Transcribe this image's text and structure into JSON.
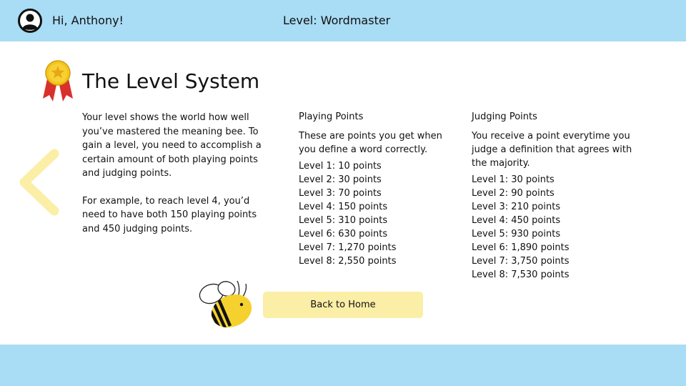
{
  "header": {
    "avatar_icon": "user-circle-icon",
    "greeting": "Hi, Anthony!",
    "level": "Level: Wordmaster"
  },
  "page": {
    "title": "The Level System",
    "medal_icon": "award-medal-icon",
    "back_icon": "chevron-left-icon",
    "mascot": "bee-icon"
  },
  "intro": {
    "paragraphs": [
      "Your level shows the world how well you’ve mastered the meaning bee. To gain a level, you need to accomplish a certain amount of both playing points and judging points.",
      "For example, to reach level 4, you’d need to have both 150 playing points and 450 judging points."
    ]
  },
  "playing": {
    "heading": "Playing Points",
    "description": "These are points you get when you define a word correctly.",
    "levels": [
      "Level 1: 10 points",
      "Level 2: 30 points",
      "Level 3: 70 points",
      "Level 4: 150 points",
      "Level 5: 310 points",
      "Level 6: 630 points",
      "Level 7: 1,270 points",
      "Level 8: 2,550 points"
    ]
  },
  "judging": {
    "heading": "Judging Points",
    "description": "You receive a point everytime you judge a definition that agrees with the majority.",
    "levels": [
      "Level 1: 30 points",
      "Level 2: 90 points",
      "Level 3: 210 points",
      "Level 4: 450 points",
      "Level 5: 930 points",
      "Level 6: 1,890 points",
      "Level 7: 3,750 points",
      "Level 8: 7,530 points"
    ]
  },
  "actions": {
    "back_home": "Back to Home"
  },
  "colors": {
    "bar": "#a9dcf5",
    "button": "#fbeea6",
    "arrow": "#fbeea6",
    "medal_gold": "#f5c518",
    "ribbon_red": "#d9302b"
  }
}
